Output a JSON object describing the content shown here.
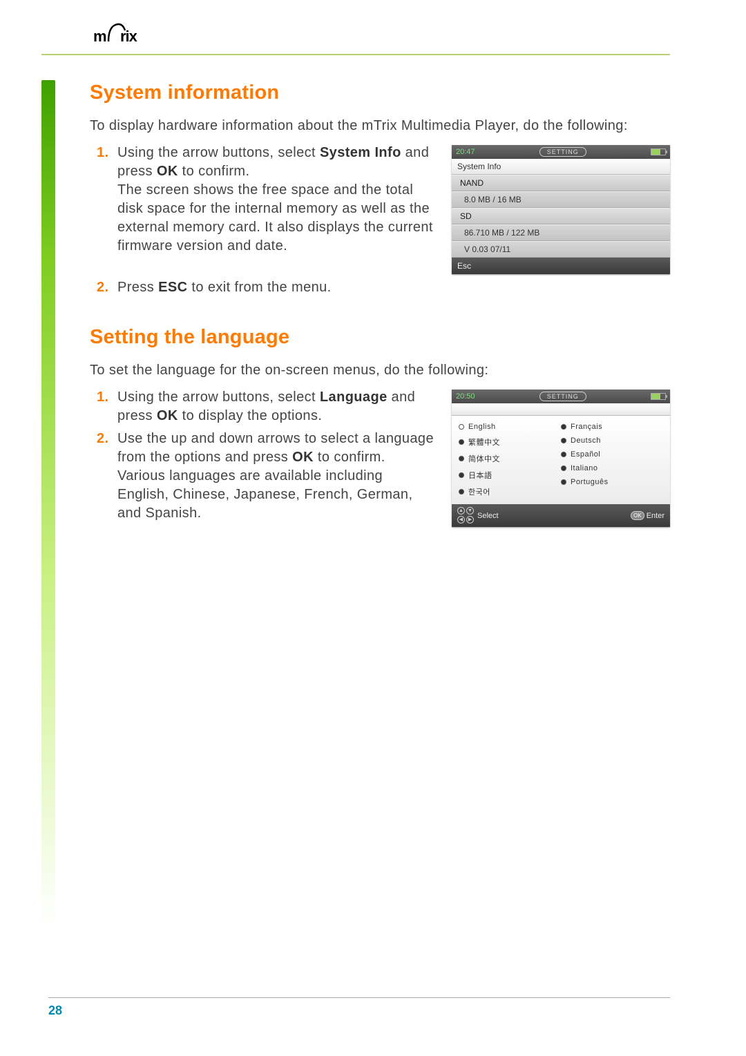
{
  "brand": "mTrix",
  "page_number": "28",
  "sections": {
    "sysinfo": {
      "title": "System information",
      "intro": "To display hardware information about the mTrix Multimedia Player, do the following:",
      "step1_a": "Using the arrow buttons, select ",
      "step1_b": "System Info",
      "step1_c": " and press ",
      "step1_d": "OK",
      "step1_e": " to confirm.",
      "step1_body": "The screen shows the free space and the total disk space for the internal memory as well as the external memory card. It also displays the current firmware version and date.",
      "step2_a": "Press ",
      "step2_b": "ESC",
      "step2_c": " to exit from the menu."
    },
    "lang": {
      "title": "Setting the language",
      "intro": "To set the language for the on-screen menus, do the following:",
      "step1_a": "Using the arrow buttons, select ",
      "step1_b": "Language",
      "step1_c": " and press ",
      "step1_d": "OK",
      "step1_e": " to display the options.",
      "step2_a": "Use the up and down arrows to select a language from the options and press ",
      "step2_b": "OK",
      "step2_c": " to confirm. Various languages are available including English, Chinese, Japanese, French, German, and Spanish."
    }
  },
  "device1": {
    "time": "20:47",
    "mode": "SETTING",
    "subtitle": "System Info",
    "rows": [
      {
        "label": "NAND",
        "value": "8.0 MB / 16 MB"
      },
      {
        "label": "SD",
        "value": "86.710 MB / 122 MB"
      }
    ],
    "version_row": "V 0.03 07/11",
    "footer": "Esc"
  },
  "device2": {
    "time": "20:50",
    "mode": "SETTING",
    "col1": [
      {
        "label": "English",
        "selected": true
      },
      {
        "label": "繁體中文",
        "selected": false
      },
      {
        "label": "简体中文",
        "selected": false
      },
      {
        "label": "日本語",
        "selected": false
      },
      {
        "label": "한국어",
        "selected": false
      }
    ],
    "col2": [
      {
        "label": "Français",
        "selected": false
      },
      {
        "label": "Deutsch",
        "selected": false
      },
      {
        "label": "Español",
        "selected": false
      },
      {
        "label": "Italiano",
        "selected": false
      },
      {
        "label": "Português",
        "selected": false
      }
    ],
    "footer_select": "Select",
    "footer_enter": "Enter",
    "footer_ok": "OK"
  }
}
